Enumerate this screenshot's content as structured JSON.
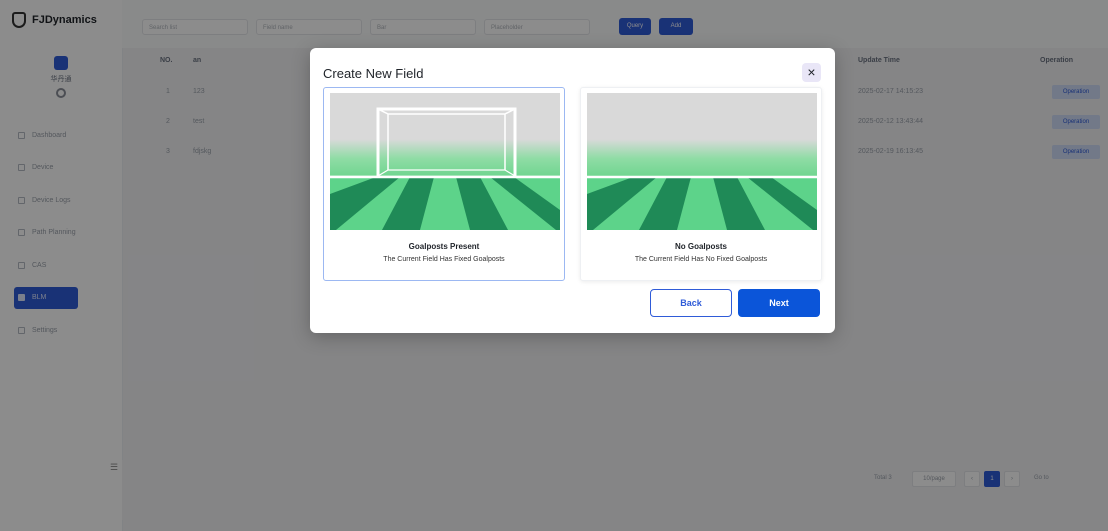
{
  "app": {
    "brand": "FJDynamics",
    "user_name": "华丹通"
  },
  "sidebar": {
    "items": [
      {
        "label": "Dashboard"
      },
      {
        "label": "Device"
      },
      {
        "label": "Device Logs"
      },
      {
        "label": "Path Planning"
      },
      {
        "label": "CAS"
      },
      {
        "label": "BLM"
      },
      {
        "label": "Settings"
      }
    ],
    "active_index": 5
  },
  "toolbar": {
    "filters": [
      "Search list",
      "Field name",
      "Bar",
      "Placeholder"
    ],
    "query_label": "Query",
    "add_label": "Add"
  },
  "table": {
    "headers": {
      "no": "NO.",
      "name": "an",
      "update_time": "Update Time",
      "operation": "Operation"
    },
    "rows": [
      {
        "no": "1",
        "name": "123",
        "update_time": "2025-02-17 14:15:23",
        "op": "Operation"
      },
      {
        "no": "2",
        "name": "test",
        "update_time": "2025-02-12 13:43:44",
        "op": "Operation"
      },
      {
        "no": "3",
        "name": "fdjskg",
        "update_time": "2025-02-19 16:13:45",
        "op": "Operation"
      }
    ]
  },
  "pagination": {
    "total": "Total 3",
    "page_size": "10/page",
    "current": "1",
    "goto": "Go to"
  },
  "modal": {
    "title": "Create New Field",
    "close_glyph": "×",
    "options": [
      {
        "title": "Goalposts Present",
        "desc": "The Current Field Has Fixed Goalposts",
        "selected": true
      },
      {
        "title": "No Goalposts",
        "desc": "The Current Field Has No Fixed Goalposts",
        "selected": false
      }
    ],
    "back_label": "Back",
    "next_label": "Next"
  },
  "colors": {
    "accent": "#0b55d9",
    "grass_dark": "#1f8a57",
    "grass_light": "#5dd38a",
    "sky": "#d9d9d9"
  }
}
